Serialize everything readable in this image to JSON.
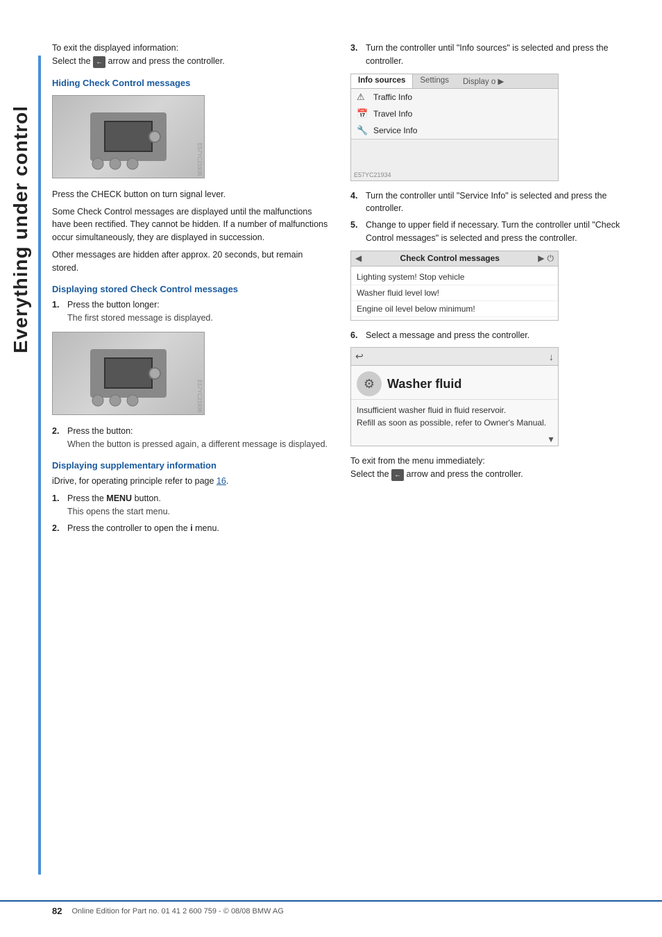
{
  "sidebar": {
    "title": "Everything under control"
  },
  "page": {
    "intro_exit": "To exit the displayed information:",
    "intro_exit_action": "Select the ← arrow and press the controller.",
    "section1_heading": "Hiding Check Control messages",
    "section1_body1": "Press the CHECK button on turn signal lever.",
    "section1_body2": "Some Check Control messages are displayed until the malfunctions have been rectified. They cannot be hidden. If a number of malfunctions occur simultaneously, they are displayed in succession.",
    "section1_body3": "Other messages are hidden after approx. 20 seconds, but remain stored.",
    "section2_heading": "Displaying stored Check Control messages",
    "step1_label": "1.",
    "step1_action": "Press the button longer:",
    "step1_sub": "The first stored message is displayed.",
    "step2_label": "2.",
    "step2_action": "Press the button:",
    "step2_sub": "When the button is pressed again, a different message is displayed.",
    "section3_heading": "Displaying supplementary information",
    "section3_body": "iDrive, for operating principle refer to page 16.",
    "step3_label": "1.",
    "step3_action": "Press the",
    "step3_menu": "MENU",
    "step3_action2": "button.",
    "step3_sub": "This opens the start menu.",
    "step4_label": "2.",
    "step4_action": "Press the controller to open the",
    "step4_icon": "i",
    "step4_action2": "menu.",
    "right_step3_label": "3.",
    "right_step3_text": "Turn the controller until \"Info sources\" is selected and press the controller.",
    "info_sources_tab": "Info sources",
    "settings_tab": "Settings",
    "display_tab": "Display o ▶",
    "info_row1": "Traffic Info",
    "info_row2": "Travel Info",
    "info_row3": "Service Info",
    "right_step4_label": "4.",
    "right_step4_text": "Turn the controller until \"Service Info\" is selected and press the controller.",
    "right_step5_label": "5.",
    "right_step5_text": "Change to upper field if necessary. Turn the controller until \"Check Control messages\" is selected and press the controller.",
    "cc_title": "Check Control messages",
    "cc_item1": "Lighting system! Stop vehicle",
    "cc_item2": "Washer fluid level low!",
    "cc_item3": "Engine oil level below minimum!",
    "right_step6_label": "6.",
    "right_step6_text": "Select a message and press the controller.",
    "wf_title": "Washer fluid",
    "wf_body1": "Insufficient washer fluid in fluid reservoir.",
    "wf_body2": "Refill as soon as possible, refer to Owner's Manual.",
    "exit_text1": "To exit from the menu immediately:",
    "exit_text2": "Select the ← arrow and press the controller.",
    "footer_page": "82",
    "footer_text": "Online Edition for Part no. 01 41 2 600 759 - © 08/08 BMW AG"
  }
}
